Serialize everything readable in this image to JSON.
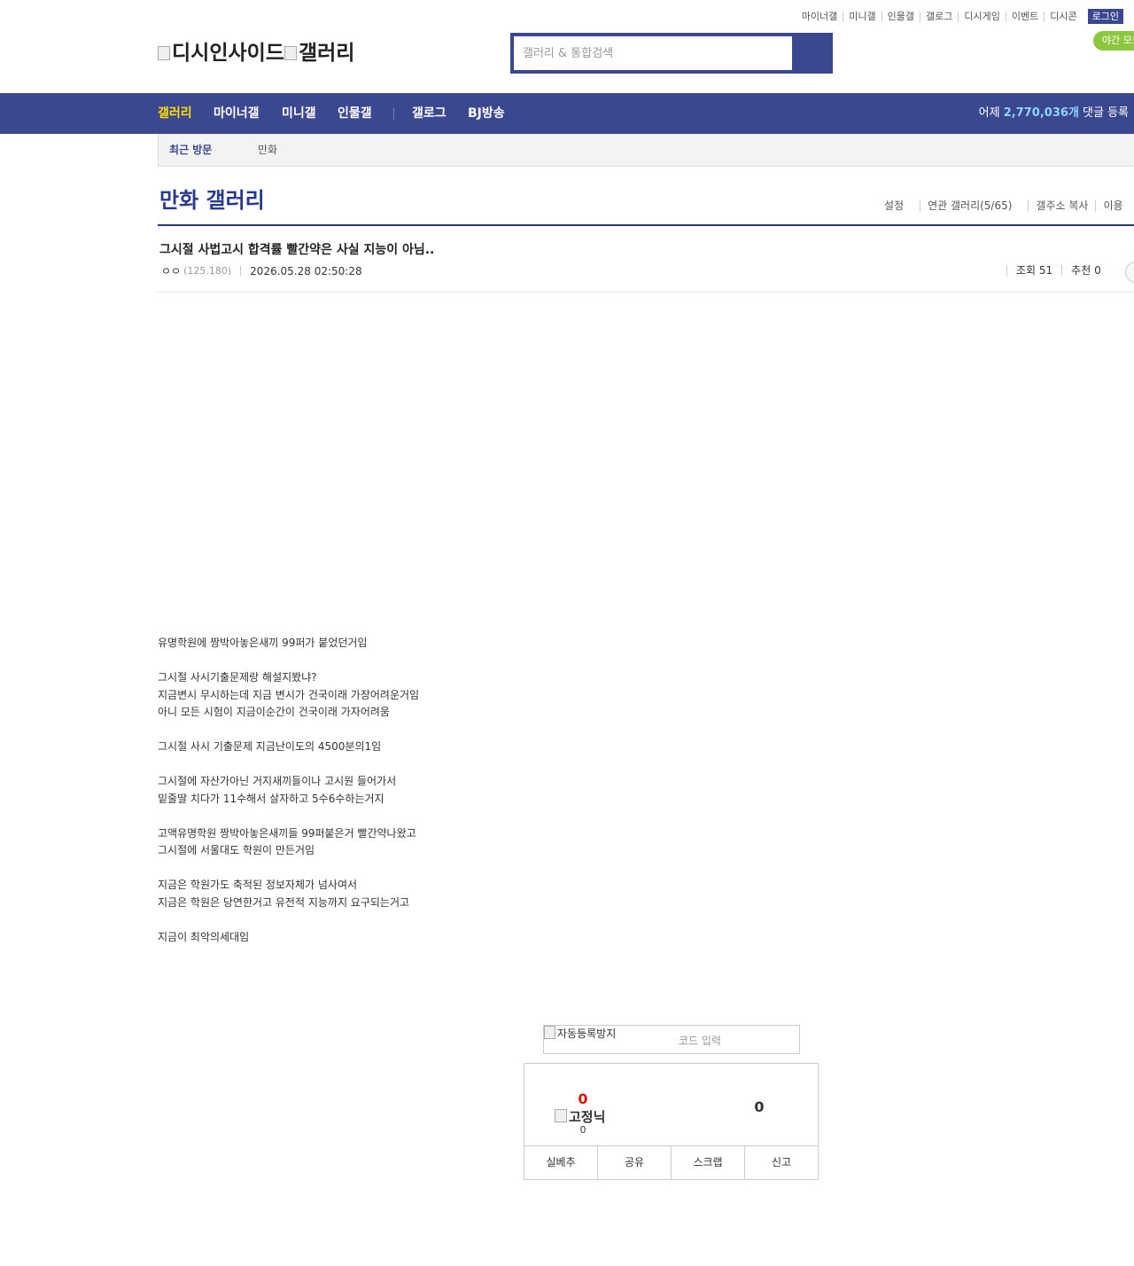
{
  "util_links": [
    "마이너갤",
    "미니갤",
    "인물갤",
    "갤로그",
    "디시게임",
    "이벤트",
    "디시콘"
  ],
  "login_label": "로그인",
  "night_mode_label": "야간 모드",
  "logo": {
    "part1": "디시인사이드",
    "part2": "갤러리"
  },
  "search": {
    "placeholder": "갤러리 & 통합검색"
  },
  "nav": {
    "items": [
      "갤러리",
      "마이너갤",
      "미니갤",
      "인물갤",
      "갤로그",
      "BJ방송"
    ],
    "stat_prefix": "어제 ",
    "stat_number": "2,770,036개",
    "stat_suffix": " 댓글 등록"
  },
  "recent": {
    "title": "최근 방문",
    "item": "만화"
  },
  "gallery": {
    "title": "만화 갤러리",
    "links": [
      "설정",
      "연관 갤러리(5/65)",
      "갤주소 복사",
      "이용"
    ]
  },
  "post": {
    "title": "그시절 사법고시 합격률 빨간약은 사실 지능이 아님..",
    "author": "ㅇㅇ",
    "ip": "(125.180)",
    "date": "2026.05.28 02:50:28",
    "views": "조회 51",
    "recommends": "추천 0",
    "body": [
      "유명학원에 짱박아놓은새끼 99퍼가 붙었던거임",
      "",
      "그시절 사시기출문제랑 해설지봤냐?",
      "지금변시 무시하는데 지금 변시가 건국이래 가장어려운거임",
      "아니 모든 시험이 지금이순간이 건국이래 가자어려움",
      "",
      "그시절 사시 기출문제 지금난이도의 4500분의1임",
      "",
      "그시절에 자산가아닌 거지새끼들이나 고시원 들어가서",
      "밑줄딸 치다가 11수해서 살자하고 5수6수하는거지",
      "",
      "고액유명학원 짱박아놓은새끼들 99퍼붙은거 빨간약나왔고",
      "그시절에 서울대도 학원이 만든거임",
      "",
      "지금은 학원가도 축적된 정보자체가 넘사여서",
      "지금은 학원은 당연한거고 유전적 지능까지 요구되는거고",
      "",
      "지금이 최악의세대임"
    ]
  },
  "captcha": {
    "img_alt": "자동등록방지",
    "placeholder": "코드 입력"
  },
  "recommend": {
    "up_count": "0",
    "fix_label": "고정닉",
    "fix_count": "0",
    "down_count": "0",
    "buttons": [
      "실베추",
      "공유",
      "스크랩",
      "신고"
    ]
  }
}
